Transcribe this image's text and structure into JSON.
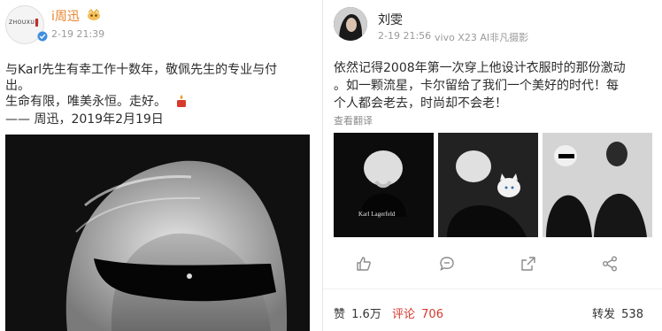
{
  "left_post": {
    "avatar_text": "ZHOUXUN",
    "username": "i周迅",
    "timestamp": "2-19 21:39",
    "lines": [
      "与Karl先生有幸工作十数年，敬佩先生的专业与付",
      "出。",
      "生命有限，唯美永恒。走好。",
      "—— 周迅，2019年2月19日"
    ]
  },
  "right_post": {
    "username": "刘雯",
    "timestamp": "2-19 21:56",
    "device": "vivo X23 AI非凡摄影",
    "lines": [
      "依然记得2008年第一次穿上他设计衣服时的那份激动",
      "。如一颗流星，卡尔留给了我们一个美好的时代！每",
      "个人都会老去，时尚却不会老！"
    ],
    "translate_link": "查看翻译",
    "thumb_caption": "Karl Lagerfeld",
    "likes_label": "赞",
    "likes_count": "1.6万",
    "comments_label": "评论",
    "comments_count": "706",
    "reposts_label": "转发",
    "reposts_count": "538"
  },
  "colors": {
    "username_orange": "#e8842e",
    "comment_red": "#d6382f",
    "icon_gray": "#8a8a8a"
  }
}
